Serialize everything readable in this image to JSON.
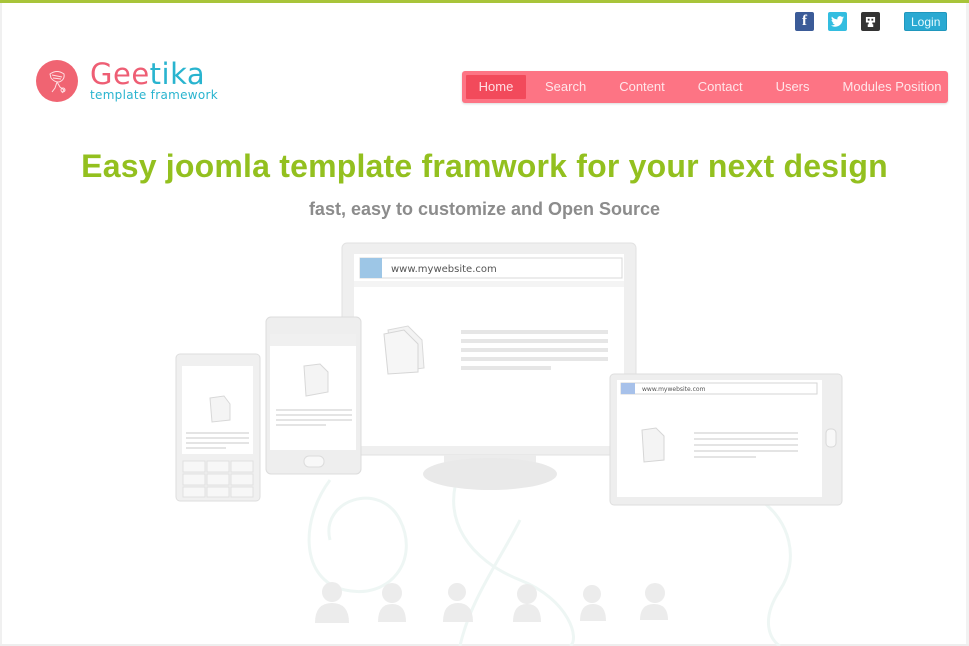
{
  "header": {
    "social": [
      {
        "name": "facebook",
        "icon": "facebook-icon",
        "glyph": "f",
        "color": "#3b5b98"
      },
      {
        "name": "twitter",
        "icon": "twitter-icon",
        "glyph": "🐦",
        "color": "#33bde0"
      },
      {
        "name": "github",
        "icon": "github-icon",
        "glyph": "◆",
        "color": "#333333"
      }
    ],
    "login_label": "Login"
  },
  "logo": {
    "name_part1": "Gee",
    "name_part2": "tika",
    "tagline": "template framework",
    "colors": {
      "primary": "#ee5e74",
      "secondary": "#29b4cf"
    }
  },
  "nav": {
    "items": [
      {
        "label": "Home",
        "active": true
      },
      {
        "label": "Search",
        "active": false
      },
      {
        "label": "Content",
        "active": false
      },
      {
        "label": "Contact",
        "active": false
      },
      {
        "label": "Users",
        "active": false
      },
      {
        "label": "Modules Position",
        "active": false
      }
    ],
    "color": "#fd7484",
    "active_color": "#f24a5b"
  },
  "hero": {
    "headline": "Easy joomla template framwork for your next design",
    "subline": "fast, easy to customize and Open Source",
    "headline_color": "#93c01f"
  },
  "illustration": {
    "desktop_url": "www.mywebsite.com",
    "tablet_url": "www.mywebsite.com",
    "user_count": 6
  },
  "theme": {
    "top_bar_color": "#a8c43a"
  }
}
